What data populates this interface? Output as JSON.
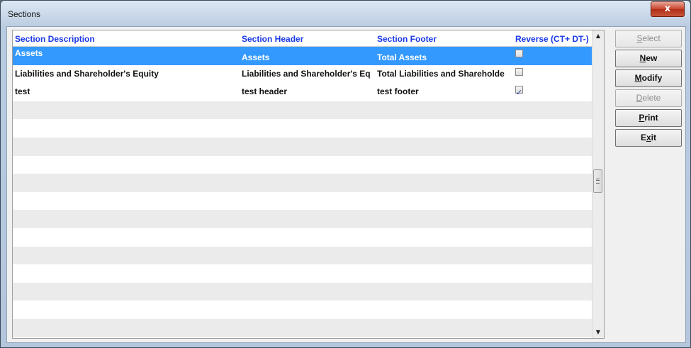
{
  "window": {
    "title": "Sections",
    "close_glyph": "x"
  },
  "grid": {
    "columns": [
      "Section Description",
      "Section Header",
      "Section Footer",
      "Reverse (CT+ DT-)"
    ],
    "rows": [
      {
        "description": "Assets",
        "header": "Assets",
        "footer": "Total Assets",
        "reverse": false,
        "selected": true
      },
      {
        "description": "Liabilities and Shareholder's Equity",
        "header": "Liabilities and Shareholder's Eq",
        "footer": "Total Liabilities and Shareholde",
        "reverse": false,
        "selected": false
      },
      {
        "description": "test",
        "header": "test header",
        "footer": "test footer",
        "reverse": true,
        "selected": false
      }
    ],
    "empty_rows": 14,
    "header_color": "#1a39e6",
    "selection_color": "#3399ff"
  },
  "buttons": {
    "select": {
      "pre": "",
      "ul": "S",
      "post": "elect",
      "enabled": false
    },
    "new": {
      "pre": "",
      "ul": "N",
      "post": "ew",
      "enabled": true
    },
    "modify": {
      "pre": "",
      "ul": "M",
      "post": "odify",
      "enabled": true
    },
    "delete": {
      "pre": "",
      "ul": "D",
      "post": "elete",
      "enabled": false
    },
    "print": {
      "pre": "",
      "ul": "P",
      "post": "rint",
      "enabled": true
    },
    "exit": {
      "pre": "E",
      "ul": "x",
      "post": "it",
      "enabled": true
    }
  },
  "scrollbar": {
    "up_icon": "▲",
    "down_icon": "▼"
  }
}
